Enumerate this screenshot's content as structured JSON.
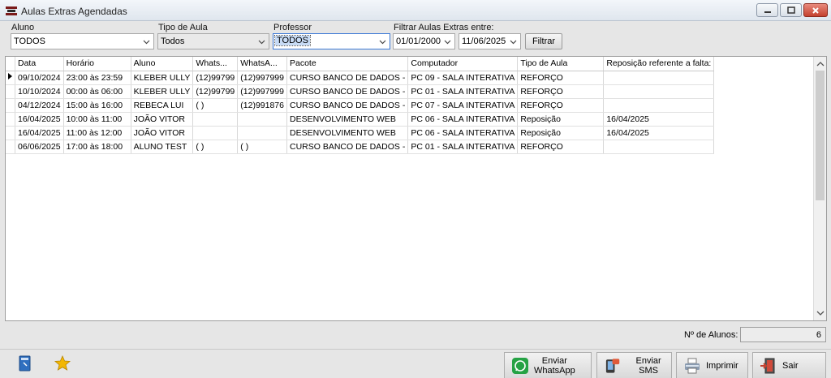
{
  "window": {
    "title": "Aulas Extras Agendadas"
  },
  "filters": {
    "aluno": {
      "label": "Aluno",
      "value": "TODOS"
    },
    "tipo_aula": {
      "label": "Tipo de Aula",
      "value": "Todos"
    },
    "professor": {
      "label": "Professor",
      "value": "TODOS"
    },
    "periodo": {
      "label": "Filtrar Aulas Extras entre:",
      "start": "01/01/2000",
      "end": "11/06/2025"
    },
    "filtrar_label": "Filtrar"
  },
  "grid": {
    "columns": [
      "Data",
      "Horário",
      "Aluno",
      "Whats...",
      "WhatsA...",
      "Pacote",
      "Computador",
      "Tipo de Aula",
      "Reposição referente a falta:"
    ],
    "rows": [
      [
        "09/10/2024",
        "23:00 às 23:59",
        "KLEBER ULLY",
        "(12)99799",
        "(12)997999",
        "CURSO BANCO DE DADOS -",
        "PC 09 - SALA INTERATIVA",
        "REFORÇO",
        ""
      ],
      [
        "10/10/2024",
        "00:00 às 06:00",
        "KLEBER ULLY",
        "(12)99799",
        "(12)997999",
        "CURSO BANCO DE DADOS -",
        "PC 01 - SALA INTERATIVA",
        "REFORÇO",
        ""
      ],
      [
        "04/12/2024",
        "15:00 às 16:00",
        "REBECA LUI",
        "(  )",
        "(12)991876",
        "CURSO BANCO DE DADOS -",
        "PC 07 - SALA INTERATIVA",
        "REFORÇO",
        ""
      ],
      [
        "16/04/2025",
        "10:00 às 11:00",
        "JOÃO VITOR",
        "",
        "",
        "DESENVOLVIMENTO WEB",
        "PC 06 - SALA INTERATIVA",
        "Reposição",
        "16/04/2025"
      ],
      [
        "16/04/2025",
        "11:00 às 12:00",
        "JOÃO VITOR",
        "",
        "",
        "DESENVOLVIMENTO WEB",
        "PC 06 - SALA INTERATIVA",
        "Reposição",
        "16/04/2025"
      ],
      [
        "06/06/2025",
        "17:00 às 18:00",
        "ALUNO TEST",
        "(  )",
        "(  )",
        "CURSO BANCO DE DADOS -",
        "PC 01 - SALA INTERATIVA",
        "REFORÇO",
        ""
      ]
    ]
  },
  "footer": {
    "count_label": "Nº de Alunos:",
    "count_value": "6",
    "whatsapp_line1": "Enviar",
    "whatsapp_line2": "WhatsApp",
    "sms_label": "Enviar SMS",
    "imprimir_label": "Imprimir",
    "sair_label": "Sair"
  },
  "colors": {
    "whatsapp": "#25a244",
    "close": "#c4412f",
    "star": "#f2b705"
  },
  "icons": [
    "app-icon",
    "minimize-icon",
    "maximize-icon",
    "close-icon",
    "chevron-down-icon",
    "book-icon",
    "star-icon",
    "whatsapp-icon",
    "sms-icon",
    "printer-icon",
    "exit-icon"
  ]
}
